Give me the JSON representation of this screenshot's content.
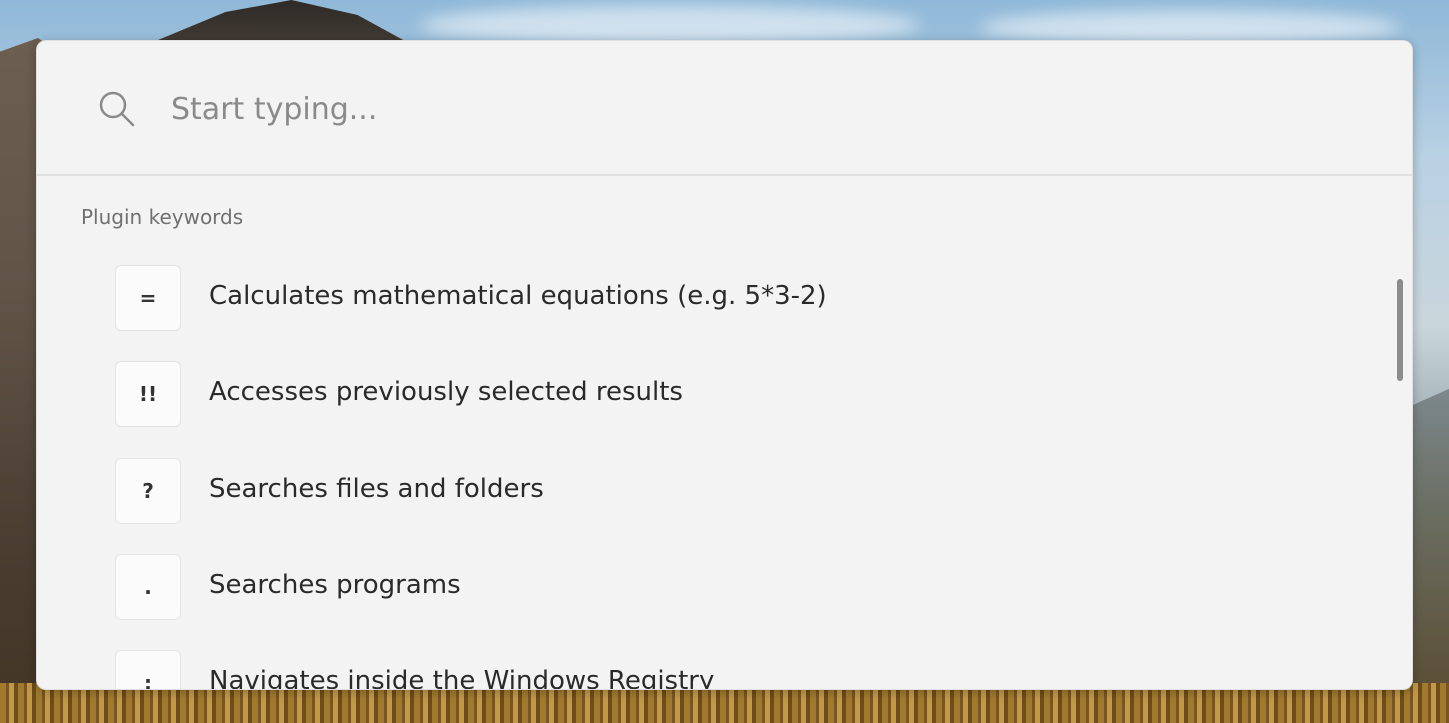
{
  "search": {
    "placeholder": "Start typing..."
  },
  "section_title": "Plugin keywords",
  "results": [
    {
      "keyword": "=",
      "description": "Calculates mathematical equations (e.g. 5*3-2)"
    },
    {
      "keyword": "!!",
      "description": "Accesses previously selected results"
    },
    {
      "keyword": "?",
      "description": "Searches files and folders"
    },
    {
      "keyword": ".",
      "description": "Searches programs"
    },
    {
      "keyword": ":",
      "description": "Navigates inside the Windows Registry"
    }
  ],
  "icons": {
    "search": "search-icon"
  },
  "colors": {
    "panel_background": "#f3f3f3",
    "placeholder_text": "#8a8a8a",
    "section_title": "#707070",
    "scrollbar": "#8c8c8c"
  }
}
